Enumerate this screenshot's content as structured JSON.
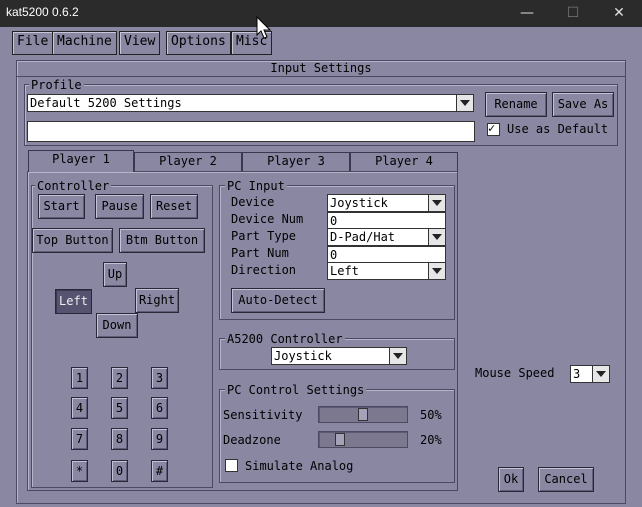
{
  "window": {
    "title": "kat5200 0.6.2",
    "minimize_icon": "minimize-icon",
    "maximize_icon": "maximize-icon",
    "close_icon": "close-icon"
  },
  "menu": [
    "File",
    "Machine",
    "View",
    "Options",
    "Misc"
  ],
  "dialog": {
    "title": "Input Settings"
  },
  "profile": {
    "label": "Profile",
    "selected": "Default 5200 Settings",
    "name_value": "",
    "rename": "Rename",
    "save_as": "Save As",
    "use_default_label": "Use as Default",
    "use_default_checked": true
  },
  "tabs": [
    "Player 1",
    "Player 2",
    "Player 3",
    "Player 4"
  ],
  "active_tab": 0,
  "controller": {
    "label": "Controller",
    "start": "Start",
    "pause": "Pause",
    "reset": "Reset",
    "top_button": "Top Button",
    "btm_button": "Btm Button",
    "up": "Up",
    "left": "Left",
    "right": "Right",
    "down": "Down",
    "selected": "Left",
    "keys": [
      "1",
      "2",
      "3",
      "4",
      "5",
      "6",
      "7",
      "8",
      "9",
      "*",
      "0",
      "#"
    ]
  },
  "pc_input": {
    "label": "PC Input",
    "device_label": "Device",
    "device": "Joystick",
    "device_num_label": "Device Num",
    "device_num": "0",
    "part_type_label": "Part Type",
    "part_type": "D-Pad/Hat",
    "part_num_label": "Part Num",
    "part_num": "0",
    "direction_label": "Direction",
    "direction": "Left",
    "auto_detect": "Auto-Detect"
  },
  "a5200": {
    "label": "A5200 Controller",
    "value": "Joystick"
  },
  "pc_control": {
    "label": "PC Control Settings",
    "sensitivity_label": "Sensitivity",
    "sensitivity": "50%",
    "sensitivity_value": 0.5,
    "deadzone_label": "Deadzone",
    "deadzone": "20%",
    "deadzone_value": 0.2,
    "simulate_label": "Simulate Analog",
    "simulate_checked": false
  },
  "mouse": {
    "label": "Mouse Speed",
    "value": "3"
  },
  "ok": "Ok",
  "cancel": "Cancel",
  "colors": {
    "background": "#8a87a2",
    "titlebar": "#2b2b2b",
    "selected_button": "#565370"
  }
}
